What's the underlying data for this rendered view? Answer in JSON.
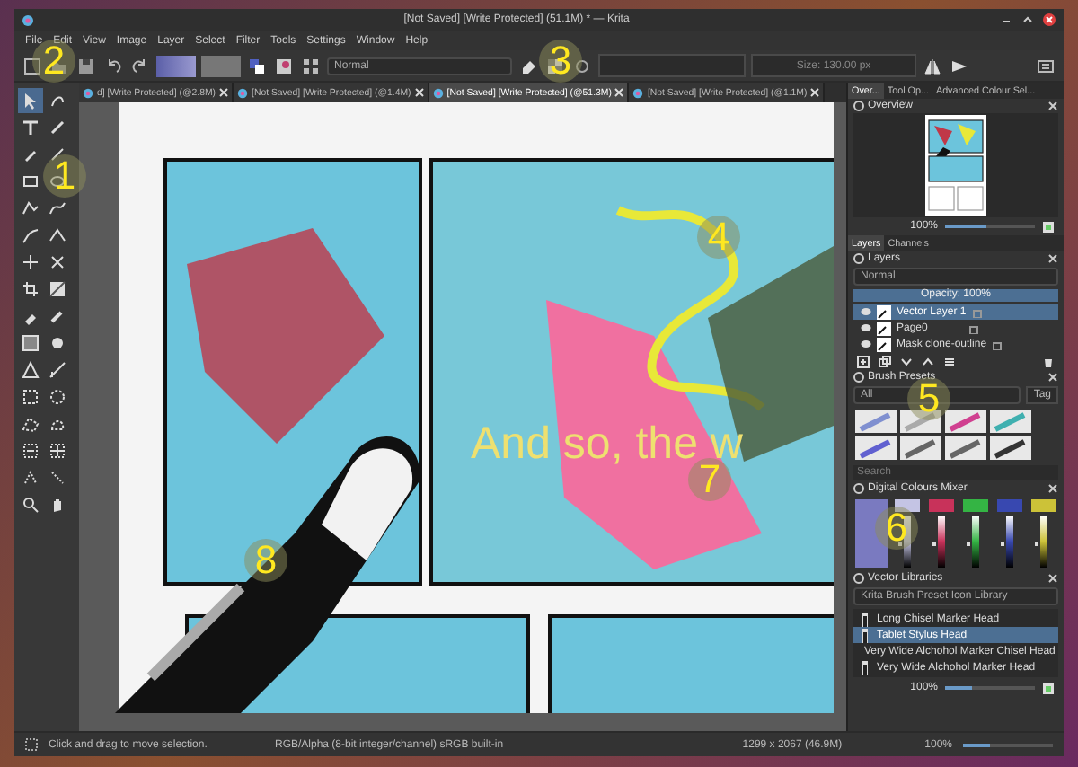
{
  "window": {
    "title": "[Not Saved] [Write Protected] (51.1M) * — Krita"
  },
  "menu": [
    "File",
    "Edit",
    "View",
    "Image",
    "Layer",
    "Select",
    "Filter",
    "Tools",
    "Settings",
    "Window",
    "Help"
  ],
  "toolbar": {
    "blend_mode": "Normal",
    "size": "Size: 130.00 px"
  },
  "doc_tabs": [
    {
      "label": "d] [Write Protected] (@2.8M)",
      "selected": false
    },
    {
      "label": "[Not Saved] [Write Protected] (@1.4M)",
      "selected": false
    },
    {
      "label": "[Not Saved] [Write Protected] (@51.3M)",
      "selected": true
    },
    {
      "label": "[Not Saved] [Write Protected] (@1.1M)",
      "selected": false
    }
  ],
  "canvas": {
    "caption": "And so, the w"
  },
  "dock_tabs": [
    {
      "label": "Over...",
      "selected": true
    },
    {
      "label": "Tool Op...",
      "selected": false
    },
    {
      "label": "Advanced Colour Sel...",
      "selected": false
    }
  ],
  "overview": {
    "title": "Overview",
    "zoom": "100%",
    "level": 0.45
  },
  "layer_tabs": [
    {
      "label": "Layers",
      "selected": true
    },
    {
      "label": "Channels",
      "selected": false
    }
  ],
  "layers": {
    "title": "Layers",
    "blend_mode": "Normal",
    "opacity": {
      "label": "Opacity: 100%",
      "level": 1
    },
    "items": [
      {
        "name": "Vector Layer 1",
        "selected": true
      },
      {
        "name": "Page0",
        "selected": false
      },
      {
        "name": "Mask clone-outline",
        "selected": false
      }
    ]
  },
  "brush_presets": {
    "title": "Brush Presets",
    "filter": "All",
    "tag": "Tag",
    "search_placeholder": "Search"
  },
  "colour_mixer": {
    "title": "Digital Colours Mixer",
    "swatches": [
      {
        "color": "#c4c4e4",
        "level": 0.5
      },
      {
        "color": "#c8325a",
        "level": 0.5
      },
      {
        "color": "#34b444",
        "level": 0.5
      },
      {
        "color": "#3848b0",
        "level": 0.5
      },
      {
        "color": "#ccc238",
        "level": 0.5
      }
    ]
  },
  "vector_libraries": {
    "title": "Vector Libraries",
    "library": "Krita Brush Preset Icon Library",
    "items": [
      {
        "name": "Long Chisel Marker Head",
        "selected": false
      },
      {
        "name": "Tablet Stylus Head",
        "selected": true
      },
      {
        "name": "Very Wide Alchohol Marker Chisel Head",
        "selected": false
      },
      {
        "name": "Very Wide Alchohol Marker Head",
        "selected": false
      }
    ],
    "zoom": "100%",
    "level": 0.3
  },
  "status_bar": {
    "hint": "Click and drag to move selection.",
    "color_space": "RGB/Alpha (8-bit integer/channel)  sRGB built-in",
    "image_size": "1299 x 2067 (46.9M)",
    "zoom": "100%",
    "level": 0.3
  },
  "callouts": [
    "1",
    "2",
    "3",
    "4",
    "5",
    "6",
    "7",
    "8"
  ]
}
